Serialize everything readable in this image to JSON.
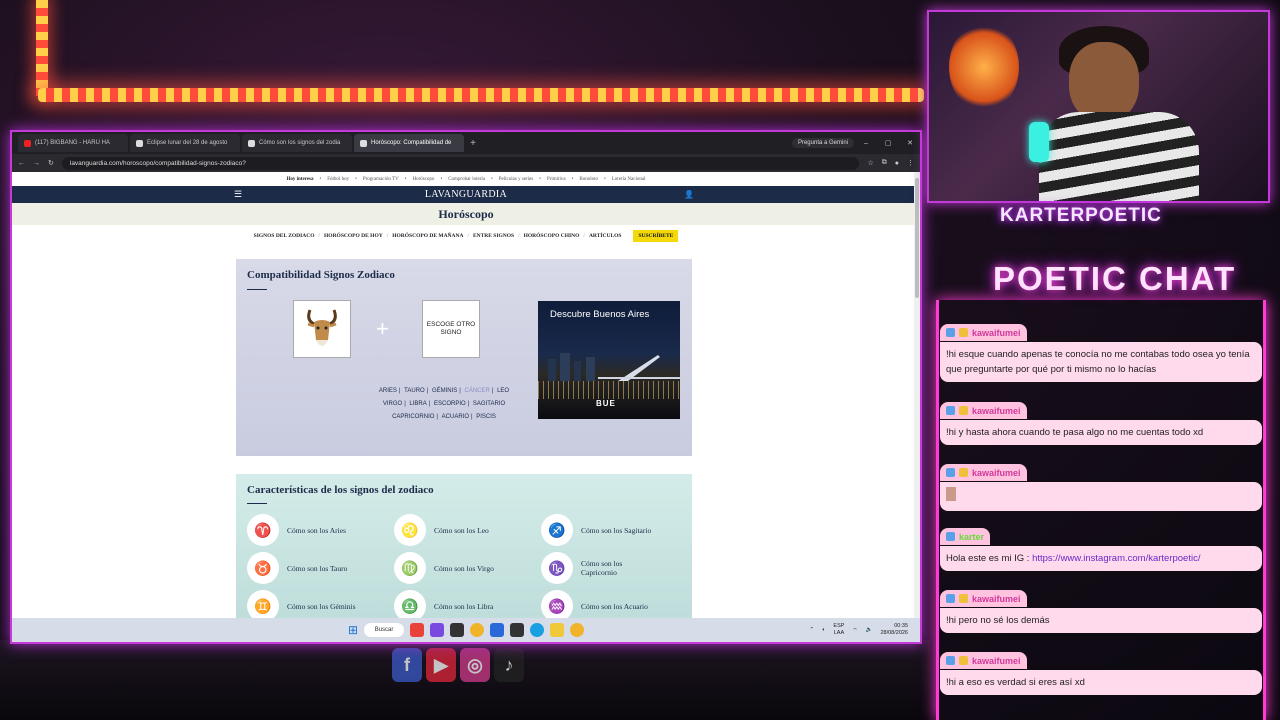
{
  "browser": {
    "tabs": [
      {
        "label": "(117) BIGBANG - HARU HA",
        "favicon": "youtube"
      },
      {
        "label": "Eclipse lunar del 28 de agosto",
        "favicon": "lavanguardia"
      },
      {
        "label": "Cómo son los signos del zodia",
        "favicon": "lavanguardia"
      },
      {
        "label": "Horóscopo: Compatibilidad de",
        "favicon": "lavanguardia"
      }
    ],
    "new_tab": "+",
    "gemini": "Pregunta a Gemini",
    "window_controls": {
      "minimize": "–",
      "maximize": "▢",
      "close": "✕"
    },
    "url": "lavanguardia.com/horoscopo/compatibilidad-signos-zodiaco?"
  },
  "site": {
    "hoy_interesa": {
      "label": "Hoy interesa",
      "links": [
        "Fútbol hoy",
        "Programación TV",
        "Horóscopo",
        "Comprobar lotería",
        "Películas y series",
        "Primitiva",
        "Bonoloto",
        "Lotería Nacional"
      ]
    },
    "brand": "LAVANGUARDIA",
    "section_title": "Horóscopo",
    "subnav": [
      "SIGNOS DEL ZODIACO",
      "HORÓSCOPO DE HOY",
      "HORÓSCOPO DE MAÑANA",
      "ENTRE SIGNOS",
      "HORÓSCOPO CHINO",
      "ARTÍCULOS"
    ],
    "subscribe": "SUSCRÍBETE",
    "compat": {
      "title": "Compatibilidad Signos Zodiaco",
      "choose_other": "ESCOGE OTRO SIGNO",
      "plus": "+",
      "signs_row1": [
        "ARIES",
        "TAURO",
        "GÉMINIS",
        "CÁNCER",
        "LEO"
      ],
      "signs_row2": [
        "VIRGO",
        "LIBRA",
        "ESCORPIO",
        "SAGITARIO"
      ],
      "signs_row3": [
        "CAPRICORNIO",
        "ACUARIO",
        "PISCIS"
      ],
      "hovered": "CÁNCER"
    },
    "ad": {
      "title": "Descubre Buenos Aires",
      "logo": "BUE"
    },
    "characteristics": {
      "title": "Características de los signos del zodiaco",
      "items": [
        {
          "label": "Cómo son los Aries",
          "icon": "♈"
        },
        {
          "label": "Cómo son los Leo",
          "icon": "♌"
        },
        {
          "label": "Cómo son los Sagitario",
          "icon": "♐"
        },
        {
          "label": "Cómo son los Tauro",
          "icon": "♉"
        },
        {
          "label": "Cómo son los Virgo",
          "icon": "♍"
        },
        {
          "label": "Cómo son los Capricornio",
          "icon": "♑"
        },
        {
          "label": "Cómo son los Géminis",
          "icon": "♊"
        },
        {
          "label": "Cómo son los Libra",
          "icon": "♎"
        },
        {
          "label": "Cómo son los Acuario",
          "icon": "♒"
        }
      ]
    }
  },
  "taskbar": {
    "search": "Buscar",
    "lang_top": "ESP",
    "lang_bottom": "LAA",
    "time": "00:35",
    "date": "28/08/2026"
  },
  "stream": {
    "streamer": "KARTERPOETIC",
    "chat_title": "POETIC CHAT",
    "messages": [
      {
        "user": "kawaifumei",
        "text": "!hi esque cuando apenas te conocía no me contabas todo osea yo tenía que preguntarte por qué por ti mismo no lo hacías"
      },
      {
        "user": "kawaifumei",
        "text": "!hi y hasta ahora cuando te pasa algo no me cuentas todo xd"
      },
      {
        "user": "kawaifumei",
        "text": ""
      },
      {
        "user": "karter",
        "text": "Hola este es mi IG : ",
        "link": "https://www.instagram.com/karterpoetic/"
      },
      {
        "user": "kawaifumei",
        "text": "!hi pero no sé los demás"
      },
      {
        "user": "kawaifumei",
        "text": "!hi a eso es verdad si eres así xd"
      }
    ]
  },
  "colors": {
    "accent_neon": "#c43ad8",
    "vanguardia_navy": "#1b2b48",
    "subscribe_yellow": "#f3d90a"
  }
}
